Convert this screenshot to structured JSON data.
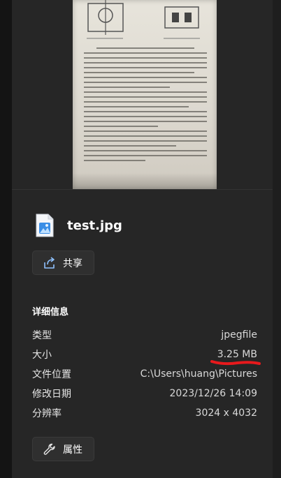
{
  "file": {
    "name": "test.jpg",
    "icon": "image-file-icon"
  },
  "actions": {
    "share_label": "共享",
    "share_icon": "share-icon",
    "properties_label": "属性",
    "properties_icon": "wrench-icon"
  },
  "details": {
    "title": "详细信息",
    "rows": [
      {
        "label": "类型",
        "value": "jpegfile"
      },
      {
        "label": "大小",
        "value": "3.25 MB"
      },
      {
        "label": "文件位置",
        "value": "C:\\Users\\huang\\Pictures"
      },
      {
        "label": "修改日期",
        "value": "2023/12/26 14:09"
      },
      {
        "label": "分辨率",
        "value": "3024 x 4032"
      }
    ]
  },
  "annotation": {
    "color": "#e8191c"
  },
  "colors": {
    "panel": "#262626",
    "background": "#1b1b1b",
    "accent": "#4aa3f0"
  }
}
